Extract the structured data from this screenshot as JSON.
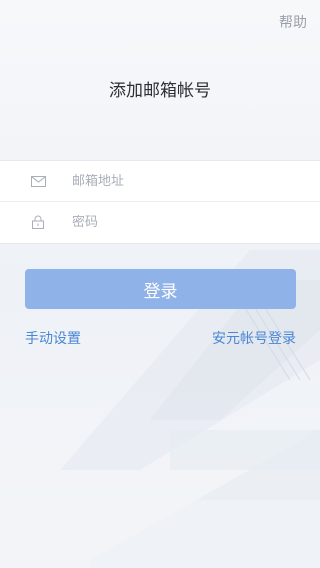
{
  "header": {
    "help_label": "帮助"
  },
  "title": "添加邮箱帐号",
  "form": {
    "email": {
      "icon": "mail-icon",
      "placeholder": "邮箱地址",
      "value": ""
    },
    "password": {
      "icon": "lock-icon",
      "placeholder": "密码",
      "value": ""
    }
  },
  "login_button_label": "登录",
  "links": {
    "manual_setup": "手动设置",
    "anyuan_login": "安元帐号登录"
  },
  "colors": {
    "accent": "#4a86d6",
    "button_bg": "#8fb2e8",
    "background": "#f6f7fa"
  }
}
